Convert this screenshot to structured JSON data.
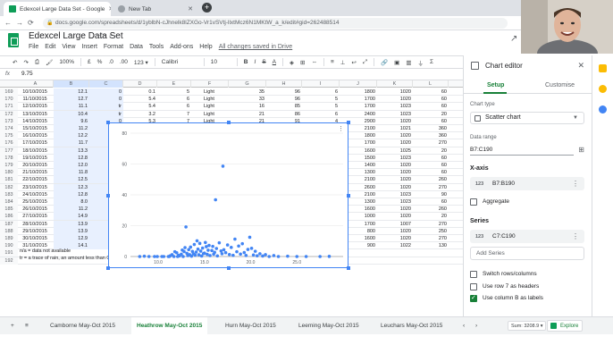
{
  "browser": {
    "tabs": [
      {
        "title": "Edexcel Large Data Set - Google",
        "active": true
      },
      {
        "title": "New Tab",
        "active": false
      }
    ],
    "url": "docs.google.com/spreadsheets/d/1yblbN-cJhnelk8lZXGo-Vr1vSVtj-llxtMcz6N1MKtW_a_k/edit#gid=262488514"
  },
  "sheets": {
    "title": "Edexcel Large Data Set",
    "menu": [
      "File",
      "Edit",
      "View",
      "Insert",
      "Format",
      "Data",
      "Tools",
      "Add-ons",
      "Help"
    ],
    "saved_status": "All changes saved in Drive",
    "toolbar": {
      "zoom": "100%",
      "currency": "£",
      "percent": "%",
      "dec0": ".0",
      "dec00": ".00",
      "format123": "123 ▾",
      "font": "Calibri",
      "font_size": "10",
      "bold": "B",
      "italic": "I",
      "strike": "S",
      "text_color": "A"
    },
    "formula_bar": {
      "label": "fx",
      "value": "9.75"
    }
  },
  "grid": {
    "columns": [
      "A",
      "B",
      "C",
      "D",
      "E",
      "F",
      "G",
      "H",
      "I",
      "J",
      "K",
      "L"
    ],
    "rows": [
      {
        "n": "169",
        "cells": [
          "10/10/2015",
          "12.1",
          "0",
          "0.1",
          "5",
          "Light",
          "35",
          "96",
          "6",
          "1800",
          "1020",
          "60"
        ]
      },
      {
        "n": "170",
        "cells": [
          "11/10/2015",
          "12.7",
          "0",
          "5.4",
          "6",
          "Light",
          "33",
          "96",
          "5",
          "1700",
          "1020",
          "60"
        ]
      },
      {
        "n": "171",
        "cells": [
          "12/10/2015",
          "11.1",
          "tr",
          "5.4",
          "6",
          "Light",
          "16",
          "85",
          "5",
          "1700",
          "1023",
          "60"
        ]
      },
      {
        "n": "172",
        "cells": [
          "13/10/2015",
          "10.4",
          "tr",
          "3.2",
          "7",
          "Light",
          "21",
          "86",
          "6",
          "2400",
          "1023",
          "20"
        ]
      },
      {
        "n": "173",
        "cells": [
          "14/10/2015",
          "9.6",
          "0",
          "5.3",
          "7",
          "Light",
          "21",
          "91",
          "4",
          "2900",
          "1020",
          "60"
        ]
      },
      {
        "n": "174",
        "cells": [
          "15/10/2015",
          "11.2",
          "",
          "",
          "",
          "",
          "",
          "",
          "",
          "2100",
          "1021",
          "360"
        ]
      },
      {
        "n": "175",
        "cells": [
          "16/10/2015",
          "12.2",
          "",
          "",
          "",
          "",
          "",
          "",
          "",
          "1800",
          "1020",
          "360"
        ]
      },
      {
        "n": "176",
        "cells": [
          "17/10/2015",
          "11.7",
          "",
          "",
          "",
          "",
          "",
          "",
          "",
          "1700",
          "1020",
          "270"
        ]
      },
      {
        "n": "177",
        "cells": [
          "18/10/2015",
          "13.3",
          "",
          "",
          "",
          "",
          "",
          "",
          "",
          "1600",
          "1025",
          "20"
        ]
      },
      {
        "n": "178",
        "cells": [
          "19/10/2015",
          "12.8",
          "",
          "",
          "",
          "",
          "",
          "",
          "",
          "1500",
          "1023",
          "60"
        ]
      },
      {
        "n": "179",
        "cells": [
          "20/10/2015",
          "12.0",
          "",
          "",
          "",
          "",
          "",
          "",
          "",
          "1400",
          "1020",
          "60"
        ]
      },
      {
        "n": "180",
        "cells": [
          "21/10/2015",
          "11.8",
          "",
          "",
          "",
          "",
          "",
          "",
          "",
          "1300",
          "1020",
          "60"
        ]
      },
      {
        "n": "181",
        "cells": [
          "22/10/2015",
          "12.5",
          "",
          "",
          "",
          "",
          "",
          "",
          "",
          "2100",
          "1020",
          "260"
        ]
      },
      {
        "n": "182",
        "cells": [
          "23/10/2015",
          "12.3",
          "",
          "",
          "",
          "",
          "",
          "",
          "",
          "2600",
          "1020",
          "270"
        ]
      },
      {
        "n": "183",
        "cells": [
          "24/10/2015",
          "12.8",
          "",
          "",
          "",
          "",
          "",
          "",
          "",
          "2100",
          "1023",
          "90"
        ]
      },
      {
        "n": "184",
        "cells": [
          "25/10/2015",
          "8.0",
          "",
          "",
          "",
          "",
          "",
          "",
          "",
          "1300",
          "1023",
          "60"
        ]
      },
      {
        "n": "185",
        "cells": [
          "26/10/2015",
          "11.2",
          "",
          "",
          "",
          "",
          "",
          "",
          "",
          "1600",
          "1020",
          "260"
        ]
      },
      {
        "n": "186",
        "cells": [
          "27/10/2015",
          "14.9",
          "",
          "",
          "",
          "",
          "",
          "",
          "",
          "1000",
          "1020",
          "20"
        ]
      },
      {
        "n": "187",
        "cells": [
          "28/10/2015",
          "13.9",
          "",
          "",
          "",
          "",
          "",
          "",
          "",
          "1700",
          "1007",
          "270"
        ]
      },
      {
        "n": "188",
        "cells": [
          "29/10/2015",
          "13.9",
          "",
          "",
          "",
          "",
          "",
          "",
          "",
          "800",
          "1020",
          "250"
        ]
      },
      {
        "n": "189",
        "cells": [
          "30/10/2015",
          "12.9",
          "",
          "",
          "",
          "",
          "",
          "",
          "",
          "1600",
          "1020",
          "270"
        ]
      },
      {
        "n": "190",
        "cells": [
          "31/10/2015",
          "14.1",
          "",
          "",
          "",
          "",
          "",
          "",
          "",
          "900",
          "1022",
          "130"
        ]
      },
      {
        "n": "191",
        "cells": [
          "",
          "",
          "",
          "",
          "",
          "",
          "",
          "",
          "",
          "",
          "",
          ""
        ]
      },
      {
        "n": "192",
        "cells": [
          "",
          "",
          "",
          "",
          "",
          "",
          "",
          "",
          "",
          "",
          "",
          ""
        ]
      }
    ],
    "notes": [
      "n/a = data not available",
      "tr = a trace of rain, an amount less than 0.05"
    ]
  },
  "chart_data": {
    "type": "scatter",
    "title": "",
    "xlabel": "",
    "ylabel": "",
    "xlim": [
      7,
      30
    ],
    "ylim": [
      0,
      80
    ],
    "yticks": [
      "0",
      "20",
      "40",
      "60",
      "80"
    ],
    "xticks": [
      "10.0",
      "15.0",
      "20.0",
      "25.0"
    ],
    "points": [
      [
        8.0,
        0
      ],
      [
        8.5,
        0.2
      ],
      [
        9.0,
        0
      ],
      [
        9.6,
        0
      ],
      [
        9.9,
        0
      ],
      [
        10.4,
        0
      ],
      [
        10.6,
        0
      ],
      [
        11.1,
        0
      ],
      [
        11.2,
        0
      ],
      [
        11.3,
        0.5
      ],
      [
        11.5,
        1.2
      ],
      [
        11.7,
        0
      ],
      [
        11.8,
        3.1
      ],
      [
        12.0,
        2.4
      ],
      [
        12.1,
        0
      ],
      [
        12.2,
        0.8
      ],
      [
        12.3,
        0.4
      ],
      [
        12.5,
        1.5
      ],
      [
        12.6,
        4.2
      ],
      [
        12.7,
        0
      ],
      [
        12.8,
        3.2
      ],
      [
        12.9,
        5.8
      ],
      [
        13.0,
        19.2
      ],
      [
        13.1,
        2.1
      ],
      [
        13.2,
        0.6
      ],
      [
        13.3,
        4.5
      ],
      [
        13.4,
        1.2
      ],
      [
        13.5,
        6.1
      ],
      [
        13.6,
        0.2
      ],
      [
        13.7,
        3.3
      ],
      [
        13.8,
        1.7
      ],
      [
        13.9,
        7.8
      ],
      [
        14.0,
        0.9
      ],
      [
        14.1,
        2.9
      ],
      [
        14.2,
        10.2
      ],
      [
        14.3,
        4.8
      ],
      [
        14.4,
        1.1
      ],
      [
        14.5,
        8.5
      ],
      [
        14.6,
        3.5
      ],
      [
        14.7,
        0.3
      ],
      [
        14.8,
        5.5
      ],
      [
        14.9,
        1.9
      ],
      [
        15.0,
        2.2
      ],
      [
        15.1,
        9.1
      ],
      [
        15.2,
        6.4
      ],
      [
        15.3,
        1.4
      ],
      [
        15.4,
        4.1
      ],
      [
        15.5,
        7.2
      ],
      [
        15.6,
        0.6
      ],
      [
        15.8,
        3.9
      ],
      [
        15.9,
        6.6
      ],
      [
        16.0,
        1.5
      ],
      [
        16.1,
        2.7
      ],
      [
        16.2,
        36.8
      ],
      [
        16.3,
        5.2
      ],
      [
        16.4,
        0.4
      ],
      [
        16.6,
        8.9
      ],
      [
        16.8,
        3.6
      ],
      [
        16.9,
        1.8
      ],
      [
        17.0,
        58.6
      ],
      [
        17.1,
        4.4
      ],
      [
        17.3,
        2.5
      ],
      [
        17.5,
        7.5
      ],
      [
        17.7,
        1.3
      ],
      [
        17.9,
        5.9
      ],
      [
        18.1,
        0.8
      ],
      [
        18.3,
        11.3
      ],
      [
        18.5,
        3.1
      ],
      [
        18.7,
        6.8
      ],
      [
        18.9,
        1.6
      ],
      [
        19.1,
        8.3
      ],
      [
        19.3,
        2.6
      ],
      [
        19.5,
        0.7
      ],
      [
        19.7,
        4.6
      ],
      [
        19.9,
        12.5
      ],
      [
        20.1,
        5.3
      ],
      [
        20.3,
        1.0
      ],
      [
        20.5,
        3.4
      ],
      [
        20.7,
        0.5
      ],
      [
        21.0,
        1.8
      ],
      [
        21.3,
        0.3
      ],
      [
        21.6,
        1.2
      ],
      [
        22.0,
        0
      ],
      [
        22.5,
        0.6
      ],
      [
        23.0,
        0
      ],
      [
        24.0,
        0.2
      ],
      [
        25.0,
        0
      ],
      [
        26.0,
        0
      ],
      [
        27.5,
        0
      ],
      [
        28.5,
        0.1
      ]
    ],
    "color": "#4285f4"
  },
  "chart_editor": {
    "title": "Chart editor",
    "tabs": [
      "Setup",
      "Customise"
    ],
    "chart_type_label": "Chart type",
    "chart_type": "Scatter chart",
    "data_range_label": "Data range",
    "data_range": "B7:C190",
    "x_axis_label": "X-axis",
    "x_axis_range": "B7:B190",
    "aggregate_label": "Aggregate",
    "series_label": "Series",
    "series_range": "C7:C190",
    "add_series": "Add Series",
    "options": [
      {
        "label": "Switch rows/columns",
        "checked": false
      },
      {
        "label": "Use row 7 as headers",
        "checked": false
      },
      {
        "label": "Use column B as labels",
        "checked": true
      }
    ],
    "range_badge": "123"
  },
  "sheet_tabs": [
    {
      "label": "Camborne May-Oct 2015",
      "active": false
    },
    {
      "label": "Heathrow May-Oct 2015",
      "active": true
    },
    {
      "label": "Hurn May-Oct 2015",
      "active": false
    },
    {
      "label": "Leeming May-Oct 2015",
      "active": false
    },
    {
      "label": "Leuchars May-Oct 2015",
      "active": false
    }
  ],
  "status": {
    "sum": "Sum: 3208.9 ▾",
    "explore": "Explore"
  }
}
